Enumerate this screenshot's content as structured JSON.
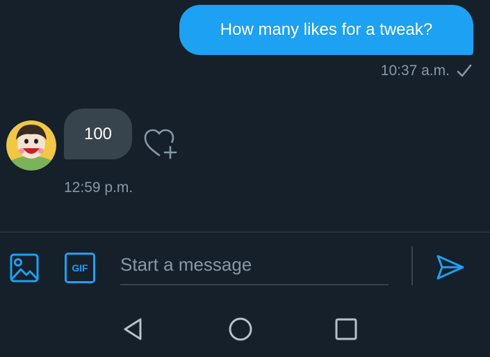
{
  "conversation": {
    "outgoing": {
      "text": "How many likes for a tweak?",
      "time": "10:37 a.m.",
      "status_icon": "check-icon"
    },
    "incoming": {
      "text": "100",
      "time": "12:59 p.m.",
      "avatar_icon": "avatar",
      "reaction_icon": "heart-add-icon"
    }
  },
  "composer": {
    "media_icon": "image-icon",
    "gif_label": "GIF",
    "placeholder": "Start a message",
    "value": "",
    "send_icon": "send-icon"
  },
  "navbar": {
    "back_icon": "back-triangle-icon",
    "home_icon": "home-circle-icon",
    "recents_icon": "recents-square-icon"
  },
  "colors": {
    "background": "#15202b",
    "accent": "#1da1f2",
    "bubble_incoming": "#38444d",
    "muted_text": "#8899a6"
  }
}
